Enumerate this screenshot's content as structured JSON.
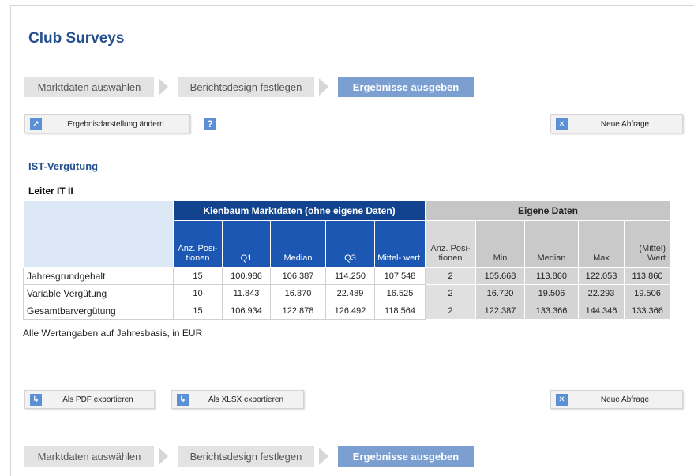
{
  "app": {
    "title": "Club Surveys"
  },
  "breadcrumb": [
    "Marktdaten auswählen",
    "Berichtsdesign festlegen",
    "Ergebnisse ausgeben"
  ],
  "toolbar": {
    "change_display": "Ergebnisdarstellung ändern",
    "help": "?",
    "new_query": "Neue Abfrage",
    "export_pdf": "Als PDF exportieren",
    "export_xlsx": "Als XLSX exportieren"
  },
  "icons": {
    "expand": "expand-icon",
    "help": "help-icon",
    "close": "close-icon",
    "export": "export-icon"
  },
  "section_title": "IST-Vergütung",
  "position_title": "Leiter IT II",
  "table": {
    "group_market": "Kienbaum Marktdaten (ohne eigene Daten)",
    "group_own": "Eigene Daten",
    "market_columns": [
      "Anz. Posi- tionen",
      "Q1",
      "Median",
      "Q3",
      "Mittel- wert"
    ],
    "own_columns": [
      "Anz. Posi- tionen",
      "Min",
      "Median",
      "Max",
      "(Mittel) Wert"
    ],
    "rows": [
      {
        "label": "Jahresgrundgehalt",
        "market": [
          "15",
          "100.986",
          "106.387",
          "114.250",
          "107.548"
        ],
        "own": [
          "2",
          "105.668",
          "113.860",
          "122.053",
          "113.860"
        ]
      },
      {
        "label": "Variable Vergütung",
        "market": [
          "10",
          "11.843",
          "16.870",
          "22.489",
          "16.525"
        ],
        "own": [
          "2",
          "16.720",
          "19.506",
          "22.293",
          "19.506"
        ]
      },
      {
        "label": "Gesamtbarvergütung",
        "market": [
          "15",
          "106.934",
          "122.878",
          "126.492",
          "118.564"
        ],
        "own": [
          "2",
          "122.387",
          "133.366",
          "144.346",
          "133.366"
        ]
      }
    ]
  },
  "footnote": "Alle Wertangaben auf Jahresbasis, in EUR",
  "colors": {
    "brand": "#244f8f",
    "market_header": "#12438f",
    "active_step": "#7a9fd0",
    "icon": "#5b8fd6"
  }
}
